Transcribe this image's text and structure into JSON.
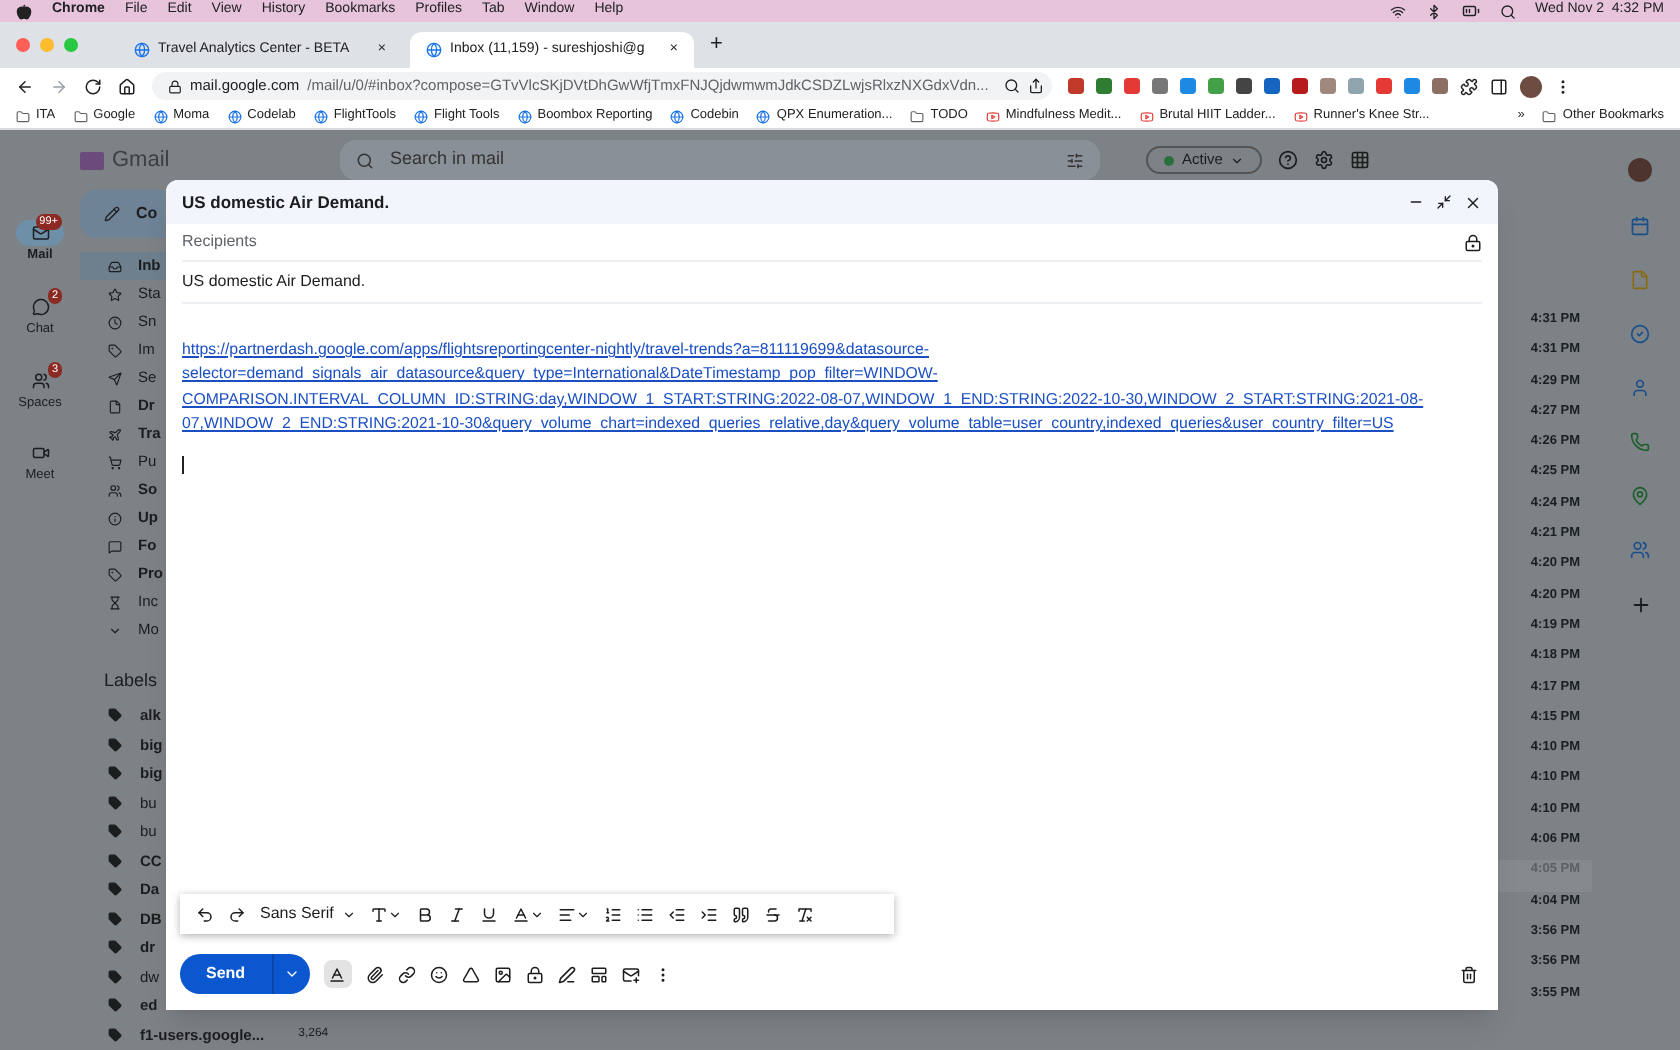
{
  "menubar": {
    "app": "Chrome",
    "menus": [
      "File",
      "Edit",
      "View",
      "History",
      "Bookmarks",
      "Profiles",
      "Tab",
      "Window",
      "Help"
    ],
    "clock": "Wed Nov 2  4:32 PM"
  },
  "tabs": [
    {
      "title": "Travel Analytics Center - BETA",
      "close": "×",
      "selected": false
    },
    {
      "title": "Inbox (11,159) - sureshjoshi@g",
      "close": "×",
      "selected": true
    }
  ],
  "new_tab": "+",
  "address": {
    "host": "mail.google.com",
    "path": "/mail/u/0/#inbox?compose=GTvVlcSKjDVtDhGwWfjTmxFNJQjdwmwmJdkCSDZLwjsRlxzNXGdxVdn..."
  },
  "bookmarks": [
    {
      "label": "ITA",
      "kind": "folder"
    },
    {
      "label": "Google",
      "kind": "folder"
    },
    {
      "label": "Moma",
      "kind": "site"
    },
    {
      "label": "Codelab",
      "kind": "site"
    },
    {
      "label": "FlightTools",
      "kind": "site"
    },
    {
      "label": "Flight Tools",
      "kind": "site"
    },
    {
      "label": "Boombox Reporting",
      "kind": "site"
    },
    {
      "label": "Codebin",
      "kind": "site"
    },
    {
      "label": "QPX Enumeration...",
      "kind": "site"
    },
    {
      "label": "TODO",
      "kind": "folder"
    },
    {
      "label": "Mindfulness Medit...",
      "kind": "video"
    },
    {
      "label": "Brutal HIIT Ladder...",
      "kind": "video"
    },
    {
      "label": "Runner's Knee Str...",
      "kind": "video"
    }
  ],
  "bookmarks_more": "»",
  "other_bookmarks": "Other Bookmarks",
  "gmail": {
    "logo": "Gmail",
    "search_placeholder": "Search in mail",
    "status": "Active",
    "compose": "Co"
  },
  "rail": [
    {
      "label": "Mail",
      "badge": "99+",
      "selected": true
    },
    {
      "label": "Chat",
      "badge": "2",
      "selected": false
    },
    {
      "label": "Spaces",
      "badge": "3",
      "selected": false
    },
    {
      "label": "Meet",
      "selected": false
    }
  ],
  "nav": [
    {
      "label": "Inb",
      "unread": true,
      "selected": true
    },
    {
      "label": "Sta",
      "unread": false,
      "selected": false
    },
    {
      "label": "Sn",
      "unread": false,
      "selected": false
    },
    {
      "label": "Im",
      "unread": false,
      "selected": false
    },
    {
      "label": "Se",
      "unread": false,
      "selected": false
    },
    {
      "label": "Dr",
      "unread": true,
      "selected": false
    },
    {
      "label": "Tra",
      "unread": true,
      "selected": false
    },
    {
      "label": "Pu",
      "unread": false,
      "selected": false
    },
    {
      "label": "So",
      "unread": true,
      "selected": false
    },
    {
      "label": "Up",
      "unread": true,
      "selected": false
    },
    {
      "label": "Fo",
      "unread": true,
      "selected": false
    },
    {
      "label": "Pro",
      "unread": true,
      "selected": false
    },
    {
      "label": "Inc",
      "unread": false,
      "selected": false
    },
    {
      "label": "Mo",
      "unread": false,
      "selected": false
    }
  ],
  "labels_heading": "Labels",
  "labels": [
    {
      "label": "alk",
      "unread": true
    },
    {
      "label": "big",
      "unread": true
    },
    {
      "label": "big",
      "unread": true
    },
    {
      "label": "bu",
      "unread": false
    },
    {
      "label": "bu",
      "unread": false
    },
    {
      "label": "CC",
      "unread": true
    },
    {
      "label": "Da",
      "unread": true
    },
    {
      "label": "DB",
      "unread": true
    },
    {
      "label": "dr",
      "unread": true
    },
    {
      "label": "dw",
      "unread": false
    },
    {
      "label": "ed",
      "unread": true
    },
    {
      "label": "f1-users.google...",
      "unread": true,
      "count": "3,264"
    }
  ],
  "times": [
    {
      "time": "4:31 PM",
      "read": false
    },
    {
      "time": "4:31 PM",
      "read": false
    },
    {
      "time": "4:29 PM",
      "read": false
    },
    {
      "time": "4:27 PM",
      "read": false
    },
    {
      "time": "4:26 PM",
      "read": false
    },
    {
      "time": "4:25 PM",
      "read": false
    },
    {
      "time": "4:24 PM",
      "read": false
    },
    {
      "time": "4:21 PM",
      "read": false
    },
    {
      "time": "4:20 PM",
      "read": false
    },
    {
      "time": "4:20 PM",
      "read": false
    },
    {
      "time": "4:19 PM",
      "read": false
    },
    {
      "time": "4:18 PM",
      "read": false
    },
    {
      "time": "4:17 PM",
      "read": false
    },
    {
      "time": "4:15 PM",
      "read": false
    },
    {
      "time": "4:10 PM",
      "read": false
    },
    {
      "time": "4:10 PM",
      "read": false
    },
    {
      "time": "4:10 PM",
      "read": false
    },
    {
      "time": "4:06 PM",
      "read": false
    },
    {
      "time": "4:05 PM",
      "read": true
    },
    {
      "time": "4:04 PM",
      "read": false
    },
    {
      "time": "3:56 PM",
      "read": false
    },
    {
      "time": "3:56 PM",
      "read": false
    },
    {
      "time": "3:55 PM",
      "read": false
    }
  ],
  "compose": {
    "title": "US domestic Air Demand.",
    "recipients_placeholder": "Recipients",
    "subject": "US domestic Air Demand.",
    "body_link": "https://partnerdash.google.com/apps/flightsreportingcenter-nightly/travel-trends?a=811119699&datasource-selector=demand_signals_air_datasource&query_type=International&DateTimestamp_pop_filter=WINDOW-COMPARISON.INTERVAL_COLUMN_ID:STRING:day,WINDOW_1_START:STRING:2022-08-07,WINDOW_1_END:STRING:2022-10-30,WINDOW_2_START:STRING:2021-08-07,WINDOW_2_END:STRING:2021-10-30&query_volume_chart=indexed_queries_relative,day&query_volume_table=user_country,indexed_queries&user_country_filter=US",
    "font": "Sans Serif",
    "send": "Send",
    "formatting_on": true
  }
}
